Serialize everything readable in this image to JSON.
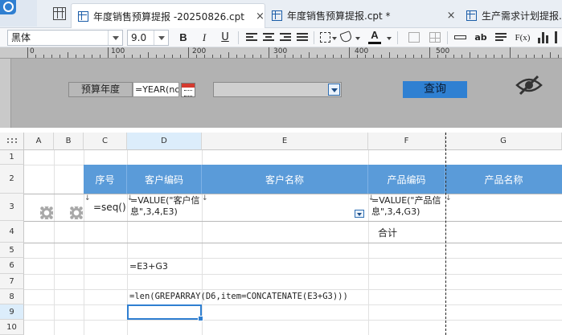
{
  "tabs": [
    {
      "label": "年度销售预算提报 -20250826.cpt",
      "close": "×",
      "active": true
    },
    {
      "label": "年度销售预算提报.cpt *",
      "close": "×",
      "active": false
    },
    {
      "label": "生产需求计划提报.cpt",
      "close": "",
      "active": false
    }
  ],
  "toolbar": {
    "font_name": "黑体",
    "font_size": "9.0",
    "bold": "B",
    "italic": "I",
    "underline": "U",
    "text_color_letter": "A",
    "ab_label": "ab",
    "fx_label": "F(x)"
  },
  "ruler": {
    "marks": [
      "0",
      "100",
      "200",
      "300",
      "400",
      "500"
    ]
  },
  "params": {
    "year_label": "预算年度",
    "year_value": "=YEAR(now",
    "query_label": "查询"
  },
  "sheet": {
    "columns": [
      "A",
      "B",
      "C",
      "D",
      "E",
      "F",
      "G"
    ],
    "rows": [
      "1",
      "2",
      "3",
      "4",
      "5",
      "6",
      "7",
      "8",
      "9",
      "10"
    ],
    "selected_column": "D",
    "selected_row": "9",
    "header_row": {
      "seq": "序号",
      "cust_code": "客户编码",
      "cust_name": "客户名称",
      "prod_code": "产品编码",
      "prod_name": "产品名称"
    },
    "c3": "=seq()",
    "d3": "=VALUE(\"客户信息\",3,4,E3)",
    "f3": "=VALUE(\"产品信息\",3,4,G3)",
    "row4_total": "合计",
    "d6": "=E3+G3",
    "d8": "=len(GREPARRAY(D6,item=CONCATENATE(E3+G3)))"
  }
}
